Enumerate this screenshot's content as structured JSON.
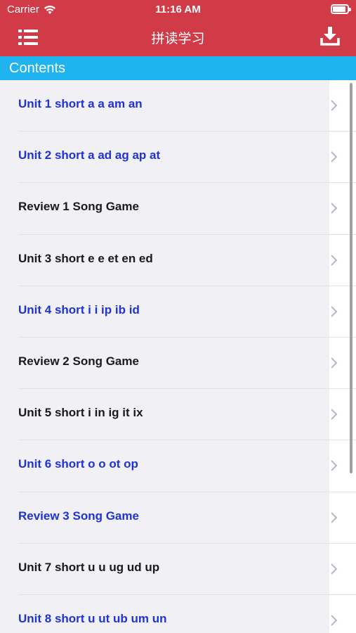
{
  "status_bar": {
    "carrier": "Carrier",
    "time": "11:16 AM"
  },
  "navbar": {
    "title": "拼读学习",
    "menu_icon": "list-icon",
    "download_icon": "download-icon"
  },
  "section": {
    "title": "Contents"
  },
  "colors": {
    "bar": "#d13b47",
    "header": "#1fb4ef",
    "link_blue": "#1f32d6"
  },
  "items": [
    {
      "label": "Unit 1 short a a am an",
      "color": "blue"
    },
    {
      "label": "Unit 2 short a ad ag ap at",
      "color": "blue"
    },
    {
      "label": "Review 1 Song Game",
      "color": "black"
    },
    {
      "label": "Unit 3 short e e et en ed",
      "color": "black"
    },
    {
      "label": "Unit 4 short i i ip ib id",
      "color": "blue"
    },
    {
      "label": "Review 2 Song Game",
      "color": "black"
    },
    {
      "label": "Unit 5 short i in ig it ix",
      "color": "black"
    },
    {
      "label": "Unit 6 short o o ot op",
      "color": "blue"
    },
    {
      "label": "Review 3 Song Game",
      "color": "blue"
    },
    {
      "label": "Unit 7 short u u ug ud up",
      "color": "black"
    },
    {
      "label": "Unit 8 short u ut ub um un",
      "color": "blue"
    }
  ]
}
